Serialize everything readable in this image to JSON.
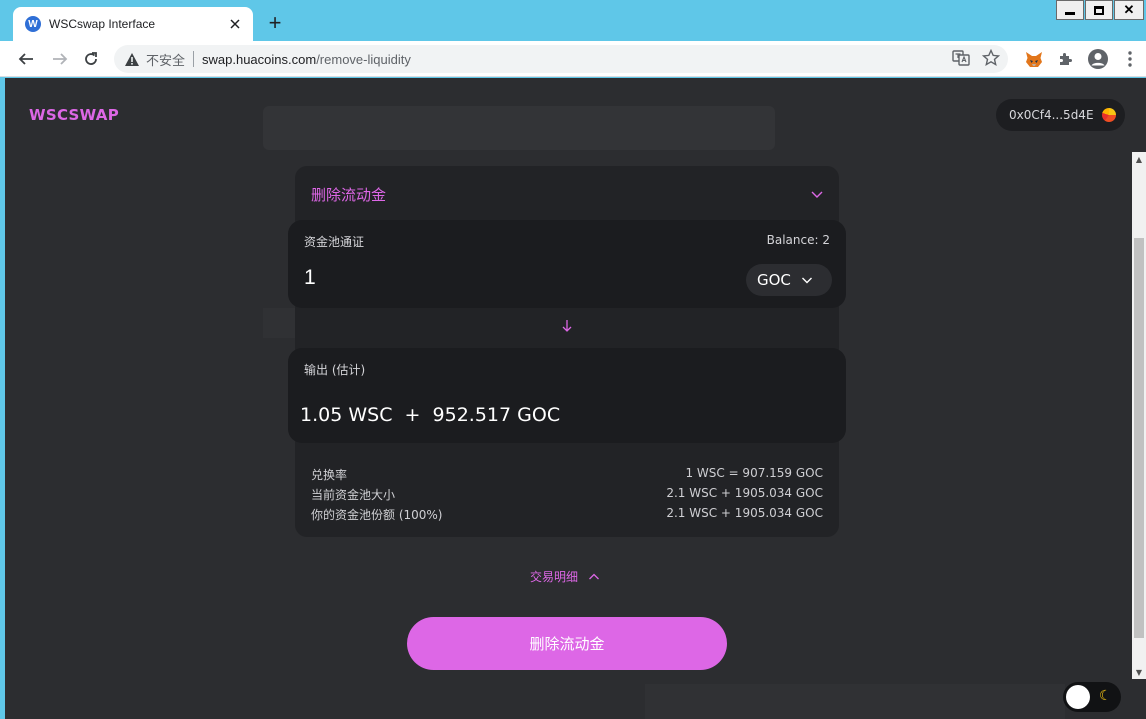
{
  "browser": {
    "tab_title": "WSCswap Interface",
    "tab_favicon": "W",
    "new_tab": "+",
    "security_label": "不安全",
    "url_host": "swap.huacoins.com",
    "url_path": "/remove-liquidity"
  },
  "app": {
    "logo": "WSCSWAP",
    "wallet_address": "0x0Cf4...5d4E"
  },
  "card": {
    "header": "删除流动金"
  },
  "input_panel": {
    "label": "资金池通证",
    "balance": "Balance: 2",
    "amount": "1",
    "token": "GOC"
  },
  "output_panel": {
    "label": "输出 (估计)",
    "value": "1.05 WSC  +  952.517 GOC"
  },
  "info": [
    {
      "label": "兑换率",
      "value": "1 WSC = 907.159 GOC"
    },
    {
      "label": "当前资金池大小",
      "value": "2.1 WSC + 1905.034 GOC"
    },
    {
      "label": "你的资金池份额 (100%)",
      "value": "2.1 WSC + 1905.034 GOC"
    }
  ],
  "details_toggle": "交易明细",
  "remove_button": "删除流动金",
  "colors": {
    "accent": "#dd67e6",
    "background": "#2c2d30",
    "panel": "#1b1c1f"
  }
}
